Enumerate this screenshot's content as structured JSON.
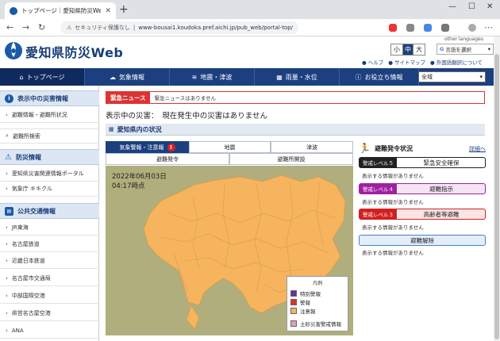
{
  "browser": {
    "tab_title": "トップページ｜愛知県防災Web",
    "security_label": "セキュリティ保護なし",
    "url": "www-bousai1.koudoka.pref.aichi.jp/pub_web/portal-top/"
  },
  "header": {
    "site_title": "愛知県防災Web",
    "other_languages": "other languages",
    "font_sizes": [
      "小",
      "中",
      "大"
    ],
    "lang_select_label": "言語を選択",
    "links": [
      "ヘルプ",
      "サイトマップ",
      "外国語翻訳について"
    ]
  },
  "nav": {
    "items": [
      "トップページ",
      "気象情報",
      "地震・津波",
      "雨量・水位",
      "お役立ち情報"
    ],
    "region_value": "全域"
  },
  "sidebar": {
    "sections": [
      {
        "title": "表示中の災害情報",
        "items": [
          "避難情報・避難所状況"
        ]
      },
      {
        "title": "",
        "items": [
          "避難所検索"
        ]
      },
      {
        "title": "防災情報",
        "items": [
          "愛知県災害関連情報ポータル",
          "気象庁 キキクル"
        ]
      },
      {
        "title": "公共交通情報",
        "items": [
          "JR東海",
          "名古屋鉄道",
          "近畿日本鉄道",
          "名古屋市交通局",
          "中部国際空港",
          "県営名古屋空港",
          "ANA"
        ]
      }
    ]
  },
  "main": {
    "alert_label": "緊急ニュース",
    "alert_message": "緊急ニュースはありません",
    "disaster_line": "表示中の災害：　現在発生中の災害はありません",
    "section_title": "愛知県内の状況",
    "tabs_row1": [
      "気象警報・注意報",
      "地震",
      "津波"
    ],
    "tabs_row2": [
      "避難発令",
      "避難所開設"
    ],
    "map_date": "2022年06月03日",
    "map_time": "04:17時点",
    "legend": {
      "title": "凡例",
      "items": [
        {
          "label": "特別警報",
          "color": "#6a2f9a"
        },
        {
          "label": "警報",
          "color": "#e0322a"
        },
        {
          "label": "注意報",
          "color": "#f6b45e"
        },
        {
          "label": "土砂災害警戒情報",
          "color": "#d9a3b8"
        }
      ]
    }
  },
  "evacuation": {
    "title": "避難発令状況",
    "more": "詳細へ",
    "levels": [
      {
        "badge": "警戒レベル５",
        "label": "緊急安全確保",
        "color": "#222222",
        "bg": "#ffffff"
      },
      {
        "badge": "警戒レベル４",
        "label": "避難指示",
        "color": "#a020a0",
        "bg": "#f4e4f4"
      },
      {
        "badge": "警戒レベル３",
        "label": "高齢者等避難",
        "color": "#d22020",
        "bg": "#fde4e4"
      },
      {
        "badge": "",
        "label": "避難解除",
        "color": "#4a7fc6",
        "bg": "#e3eefb"
      }
    ],
    "none_text": "表示する情報がありません"
  },
  "chart_data": {
    "type": "heatmap",
    "title": "愛知県内の状況",
    "subtitle": "2022年06月03日 04:17時点",
    "legend_placement": "bottom-right",
    "categories": [
      "特別警報",
      "警報",
      "注意報",
      "土砂災害警戒情報"
    ],
    "colors": [
      "#6a2f9a",
      "#e0322a",
      "#f6b45e",
      "#d9a3b8"
    ],
    "region_status": "注意報"
  }
}
